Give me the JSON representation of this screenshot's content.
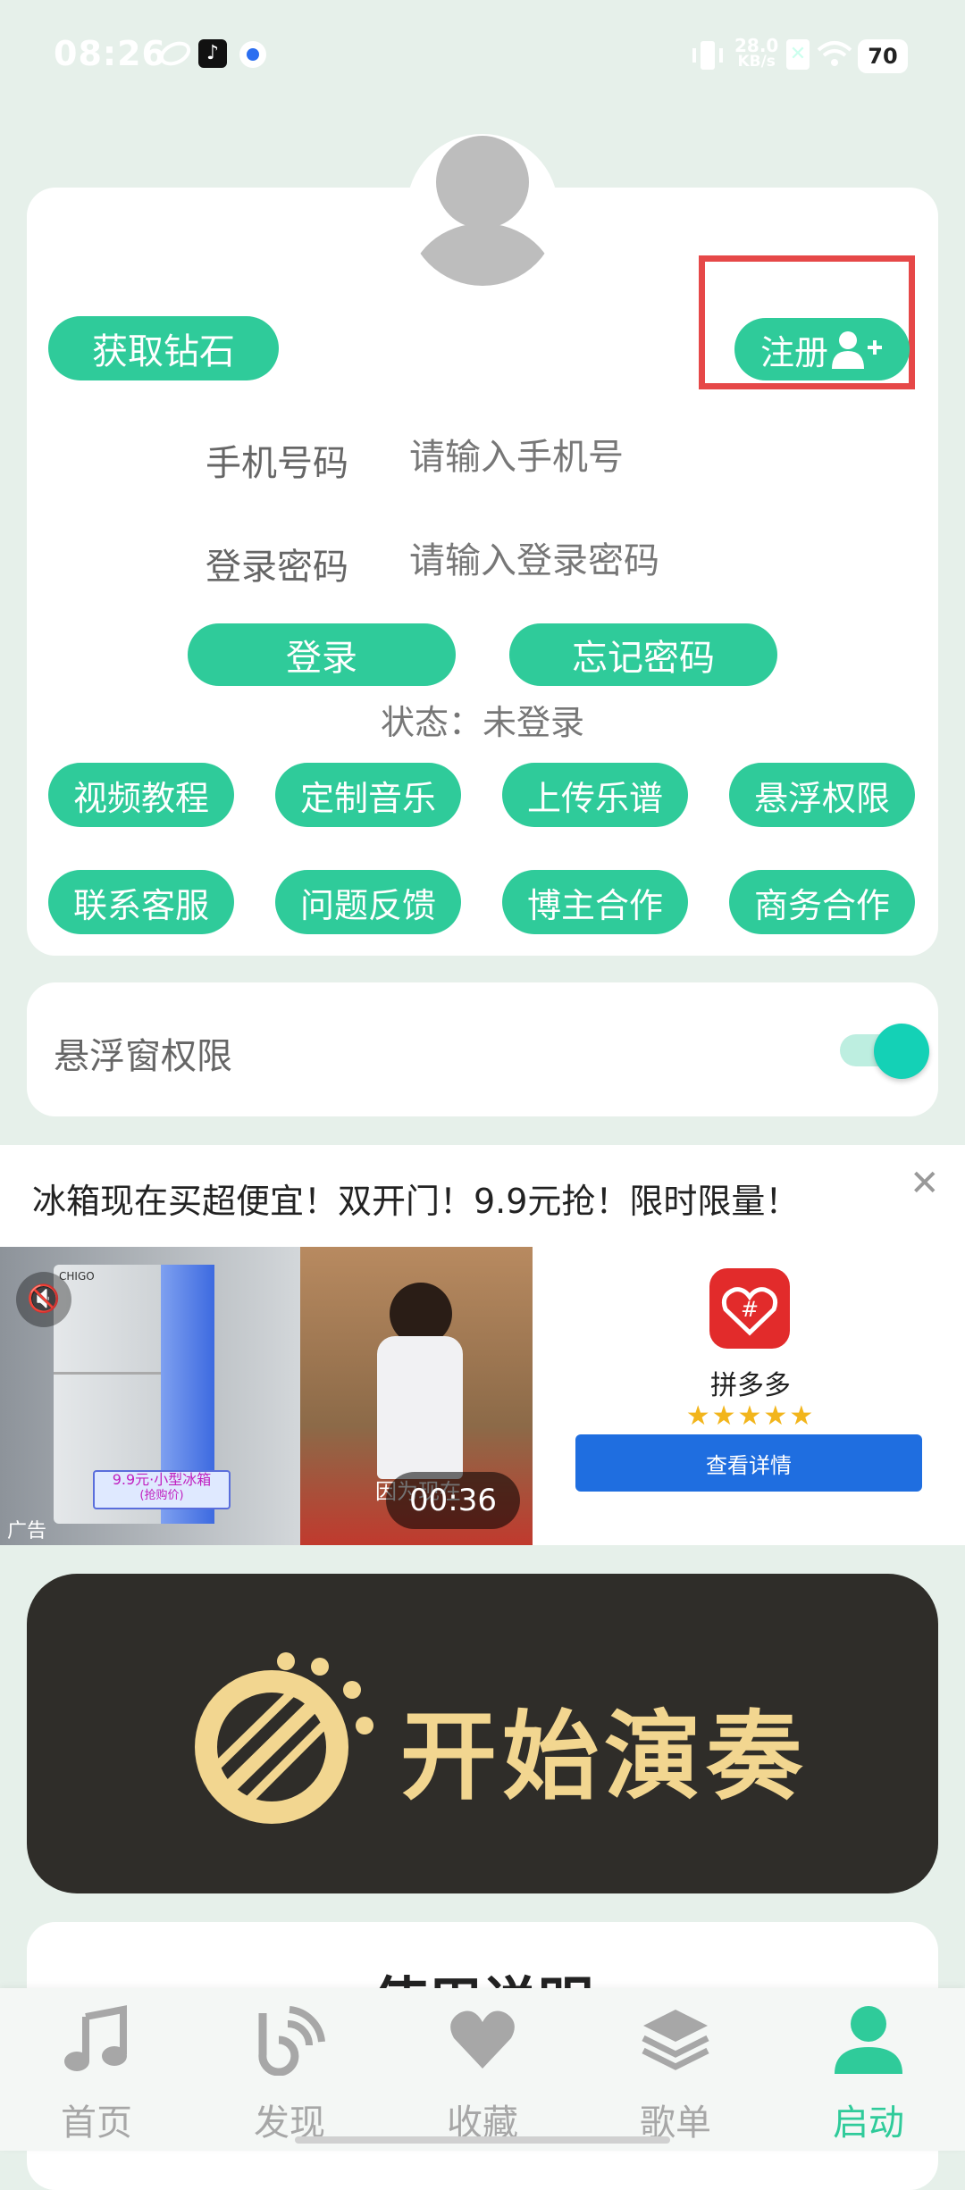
{
  "status_bar": {
    "time": "08:26",
    "net_speed_value": "28.0",
    "net_speed_unit": "KB/s",
    "battery": "70",
    "icons": [
      "cloud-icon",
      "tiktok-icon",
      "app-icon",
      "vibrate-icon",
      "sim-icon",
      "wifi-icon",
      "battery-icon"
    ]
  },
  "login": {
    "get_diamond": "获取钻石",
    "register": "注册",
    "phone_label": "手机号码",
    "phone_placeholder": "请输入手机号",
    "password_label": "登录密码",
    "password_placeholder": "请输入登录密码",
    "login_button": "登录",
    "forgot_button": "忘记密码",
    "status_text": "状态：未登录",
    "grid_buttons": [
      "视频教程",
      "定制音乐",
      "上传乐谱",
      "悬浮权限",
      "联系客服",
      "问题反馈",
      "博主合作",
      "商务合作"
    ]
  },
  "floating": {
    "label": "悬浮窗权限",
    "enabled": true
  },
  "ad": {
    "title": "冰箱现在买超便宜！双开门！9.9元抢！限时限量！",
    "brand": "CHIGO",
    "promo_line1": "9.9元·小型冰箱",
    "promo_line2": "(抢购价)",
    "ad_tag": "广告",
    "duration": "00:36",
    "caption": "因为现在",
    "app_name": "拼多多",
    "stars": "★★★★★",
    "rating": 5,
    "cta": "查看详情"
  },
  "start_play": {
    "label": "开始演奏"
  },
  "instructions": {
    "title": "使用说明"
  },
  "nav": {
    "items": [
      {
        "label": "首页",
        "icon": "music-note-icon"
      },
      {
        "label": "发现",
        "icon": "discover-icon"
      },
      {
        "label": "收藏",
        "icon": "heart-icon"
      },
      {
        "label": "歌单",
        "icon": "layers-icon"
      },
      {
        "label": "启动",
        "icon": "person-icon"
      }
    ],
    "active": 4
  },
  "colors": {
    "accent": "#2fcb9a",
    "highlight_box": "#e64848",
    "cta_blue": "#1f6ee0",
    "play_bg": "#2f2d29",
    "play_text": "#f2d690"
  }
}
